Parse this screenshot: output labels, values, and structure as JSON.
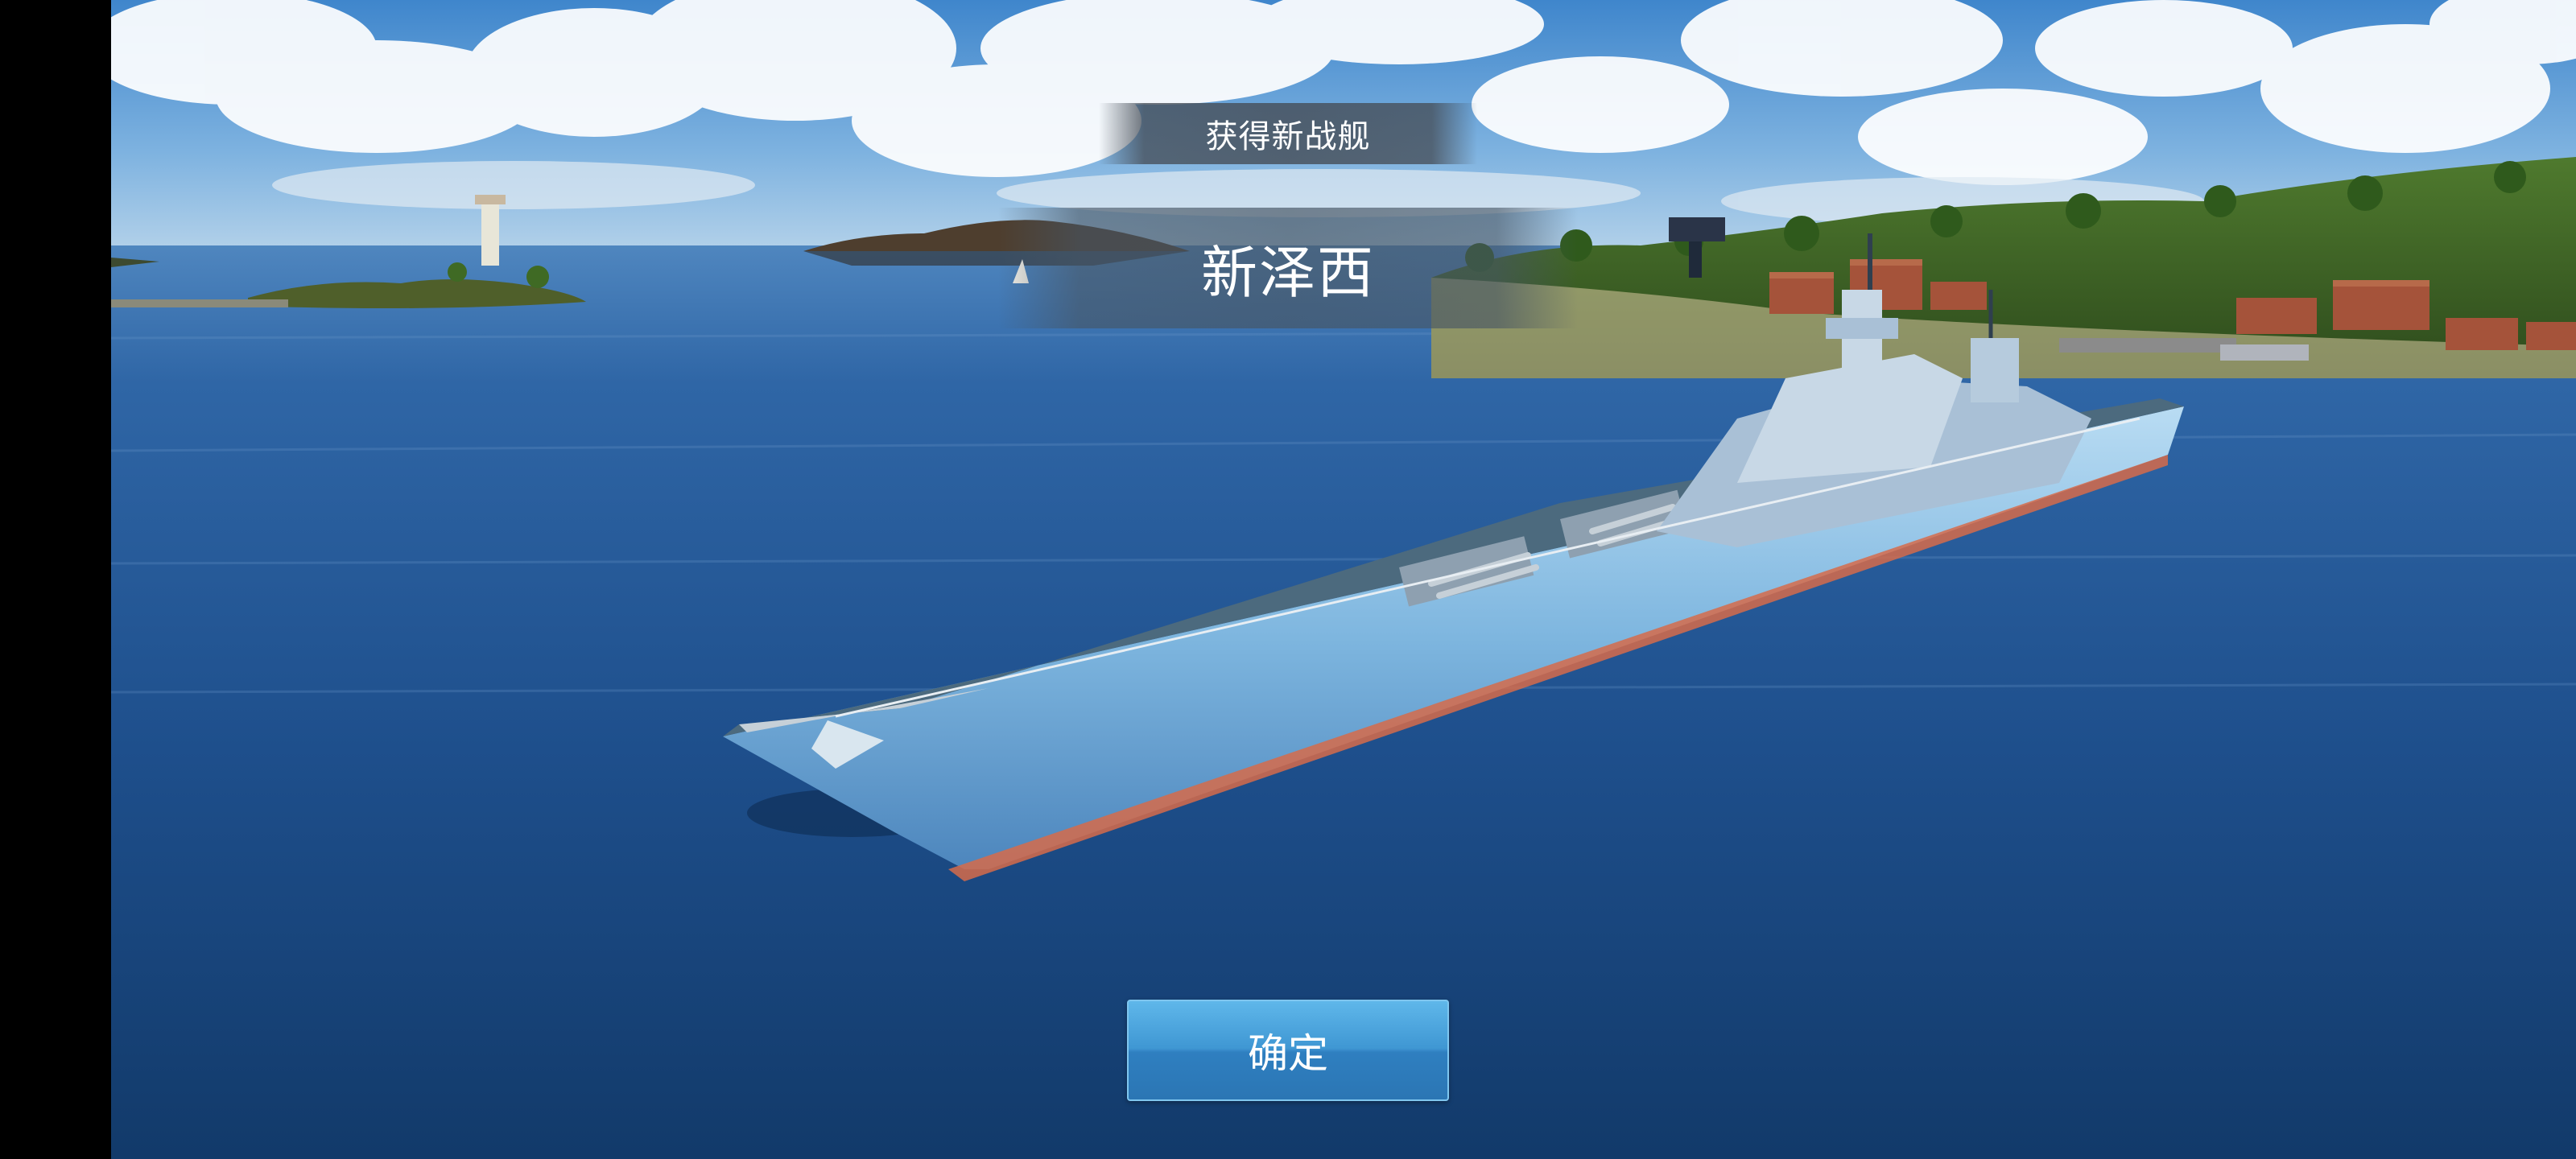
{
  "dialog": {
    "title": "获得新战舰",
    "ship_name": "新泽西",
    "confirm_label": "确定"
  },
  "colors": {
    "button": "#3f97d3",
    "banner": "#46505a",
    "sea": "#1f4f8c"
  }
}
